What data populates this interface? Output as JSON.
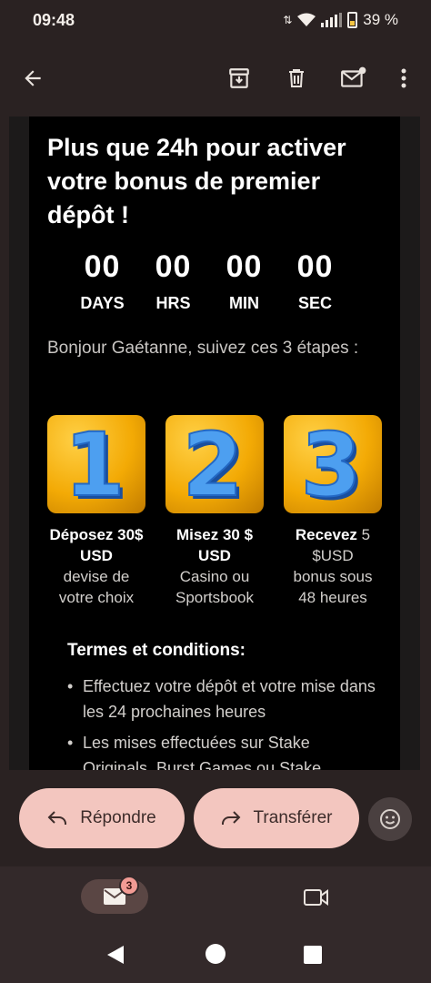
{
  "status": {
    "time": "09:48",
    "battery": "39 %"
  },
  "app_bar": {
    "icons": [
      "back-arrow-icon",
      "archive-icon",
      "trash-icon",
      "mark-unread-icon",
      "more-vert-icon"
    ]
  },
  "email": {
    "headline": "Plus que 24h pour activer votre bonus de premier dépôt !",
    "timer": [
      {
        "value": "00",
        "label": "DAYS"
      },
      {
        "value": "00",
        "label": "HRS"
      },
      {
        "value": "00",
        "label": "MIN"
      },
      {
        "value": "00",
        "label": "SEC"
      }
    ],
    "greeting": "Bonjour Gaétanne, suivez ces 3 étapes :",
    "steps": [
      {
        "number": "1",
        "strong": "Déposez 30$ USD",
        "light": "devise de votre choix"
      },
      {
        "number": "2",
        "strong": "Misez 30 $ USD",
        "light": "Casino ou Sportsbook"
      },
      {
        "number": "3",
        "strong": "Recevez",
        "strong_extra": " 5 $USD",
        "light": "bonus sous 48 heures"
      }
    ],
    "terms_title": "Termes et conditions:",
    "terms": [
      "Effectuez votre dépôt et votre mise dans les 24 prochaines heures",
      "Les mises effectuées sur Stake Originals, Burst Games ou Stake"
    ]
  },
  "actions": {
    "reply_label": "Répondre",
    "forward_label": "Transférer"
  },
  "bottom_nav": {
    "mail_badge": "3"
  },
  "colors": {
    "background": "#2a2222",
    "pill": "#f3c6bf",
    "step_gold": "#f3aa05",
    "digit_blue": "#3f8fe8"
  }
}
